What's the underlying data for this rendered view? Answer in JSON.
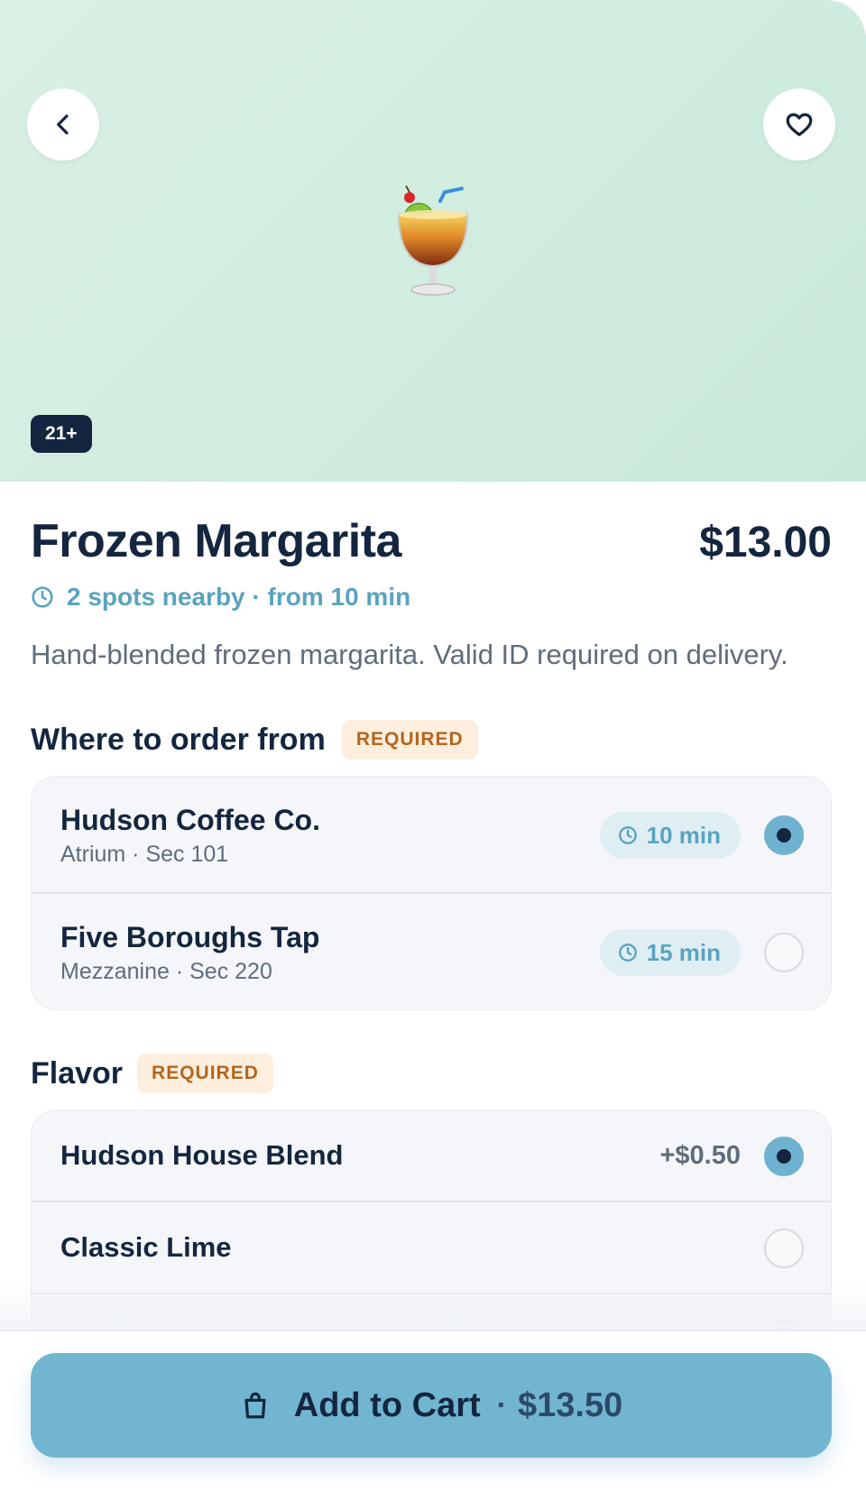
{
  "hero": {
    "emoji": "🍹",
    "age_badge": "21+",
    "back_icon": "chevron-left-icon",
    "favorite_icon": "heart-icon"
  },
  "product": {
    "title": "Frozen Margarita",
    "price": "$13.00",
    "availability": "2 spots nearby · from 10 min",
    "description": "Hand-blended frozen margarita. Valid ID required on delivery."
  },
  "locations": {
    "title": "Where to order from",
    "badge": "REQUIRED",
    "options": [
      {
        "name": "Hudson Coffee Co.",
        "sub": "Atrium · Sec 101",
        "time": "10 min",
        "selected": true
      },
      {
        "name": "Five Boroughs Tap",
        "sub": "Mezzanine · Sec 220",
        "time": "15 min",
        "selected": false
      }
    ]
  },
  "flavor": {
    "title": "Flavor",
    "badge": "REQUIRED",
    "options": [
      {
        "name": "Hudson House Blend",
        "surcharge": "+$0.50",
        "selected": true
      },
      {
        "name": "Classic Lime",
        "surcharge": "",
        "selected": false
      }
    ]
  },
  "cart": {
    "label": "Add to Cart",
    "separator": "·",
    "total": "$13.50",
    "icon": "shopping-bag-icon"
  },
  "colors": {
    "accent": "#72b5d1",
    "navy": "#14263f",
    "hero_bg": "#d0ede0",
    "badge_bg": "#fdeedd",
    "badge_text": "#b5651d"
  }
}
